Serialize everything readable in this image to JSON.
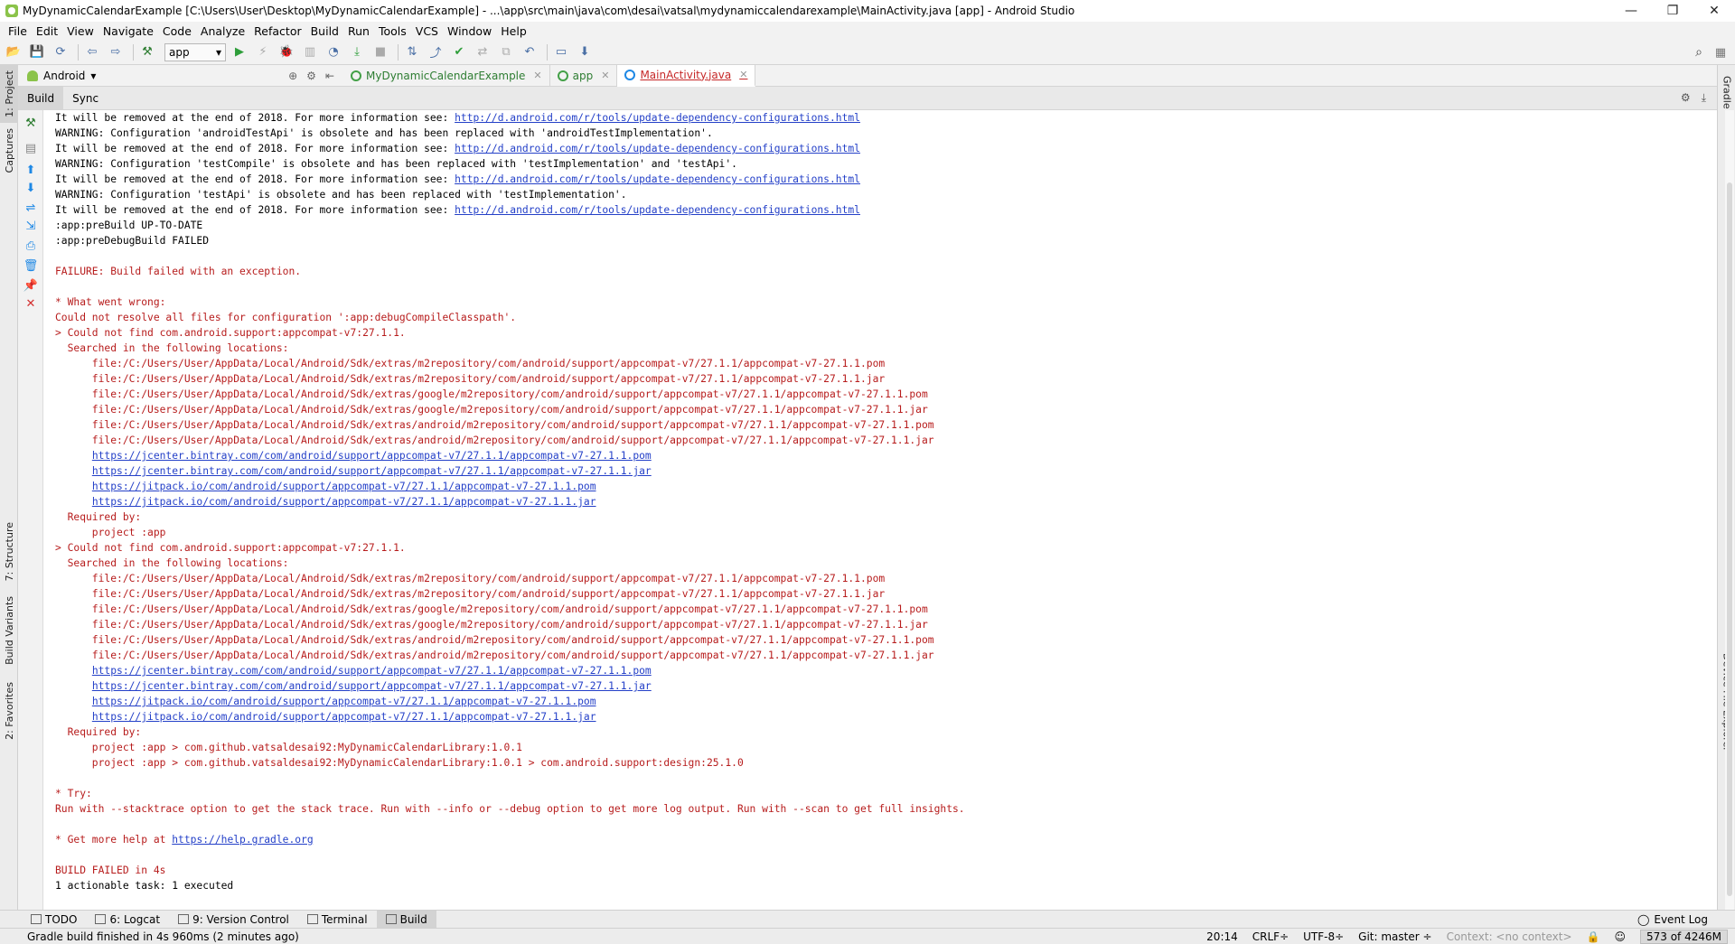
{
  "window": {
    "title": "MyDynamicCalendarExample [C:\\Users\\User\\Desktop\\MyDynamicCalendarExample] - ...\\app\\src\\main\\java\\com\\desai\\vatsal\\mydynamiccalendarexample\\MainActivity.java [app] - Android Studio",
    "minimize": "—",
    "maximize": "❐",
    "close": "✕"
  },
  "menu": [
    "File",
    "Edit",
    "View",
    "Navigate",
    "Code",
    "Analyze",
    "Refactor",
    "Build",
    "Run",
    "Tools",
    "VCS",
    "Window",
    "Help"
  ],
  "toolbar": {
    "run_config": "app"
  },
  "left_tabs": {
    "project": "1: Project",
    "captures": "Captures",
    "structure": "7: Structure",
    "build_variants": "Build Variants",
    "favorites": "2: Favorites"
  },
  "right_tabs": {
    "gradle": "Gradle",
    "device_explorer": "Device File Explorer"
  },
  "project_view": {
    "selector": "Android"
  },
  "editor_tabs": [
    {
      "label": "MyDynamicCalendarExample",
      "icon": "gradle-icon"
    },
    {
      "label": "app",
      "icon": "gradle-icon"
    },
    {
      "label": "MainActivity.java",
      "icon": "class-icon",
      "active": true
    }
  ],
  "build_panel": {
    "tabs": [
      "Build",
      "Sync"
    ]
  },
  "console_lines": [
    {
      "text": "It will be removed at the end of 2018. For more information see: ",
      "link": "http://d.android.com/r/tools/update-dependency-configurations.html",
      "color": "black"
    },
    {
      "text": "WARNING: Configuration 'androidTestApi' is obsolete and has been replaced with 'androidTestImplementation'.",
      "color": "black"
    },
    {
      "text": "It will be removed at the end of 2018. For more information see: ",
      "link": "http://d.android.com/r/tools/update-dependency-configurations.html",
      "color": "black"
    },
    {
      "text": "WARNING: Configuration 'testCompile' is obsolete and has been replaced with 'testImplementation' and 'testApi'.",
      "color": "black"
    },
    {
      "text": "It will be removed at the end of 2018. For more information see: ",
      "link": "http://d.android.com/r/tools/update-dependency-configurations.html",
      "color": "black"
    },
    {
      "text": "WARNING: Configuration 'testApi' is obsolete and has been replaced with 'testImplementation'.",
      "color": "black"
    },
    {
      "text": "It will be removed at the end of 2018. For more information see: ",
      "link": "http://d.android.com/r/tools/update-dependency-configurations.html",
      "color": "black"
    },
    {
      "text": ":app:preBuild UP-TO-DATE",
      "color": "black"
    },
    {
      "text": ":app:preDebugBuild FAILED",
      "color": "black"
    },
    {
      "text": "",
      "color": "black"
    },
    {
      "text": "FAILURE: Build failed with an exception.",
      "color": "red"
    },
    {
      "text": "",
      "color": "red"
    },
    {
      "text": "* What went wrong:",
      "color": "red"
    },
    {
      "text": "Could not resolve all files for configuration ':app:debugCompileClasspath'.",
      "color": "red"
    },
    {
      "text": "> Could not find com.android.support:appcompat-v7:27.1.1.",
      "color": "red"
    },
    {
      "text": "  Searched in the following locations:",
      "color": "red"
    },
    {
      "text": "      file:/C:/Users/User/AppData/Local/Android/Sdk/extras/m2repository/com/android/support/appcompat-v7/27.1.1/appcompat-v7-27.1.1.pom",
      "color": "red"
    },
    {
      "text": "      file:/C:/Users/User/AppData/Local/Android/Sdk/extras/m2repository/com/android/support/appcompat-v7/27.1.1/appcompat-v7-27.1.1.jar",
      "color": "red"
    },
    {
      "text": "      file:/C:/Users/User/AppData/Local/Android/Sdk/extras/google/m2repository/com/android/support/appcompat-v7/27.1.1/appcompat-v7-27.1.1.pom",
      "color": "red"
    },
    {
      "text": "      file:/C:/Users/User/AppData/Local/Android/Sdk/extras/google/m2repository/com/android/support/appcompat-v7/27.1.1/appcompat-v7-27.1.1.jar",
      "color": "red"
    },
    {
      "text": "      file:/C:/Users/User/AppData/Local/Android/Sdk/extras/android/m2repository/com/android/support/appcompat-v7/27.1.1/appcompat-v7-27.1.1.pom",
      "color": "red"
    },
    {
      "text": "      file:/C:/Users/User/AppData/Local/Android/Sdk/extras/android/m2repository/com/android/support/appcompat-v7/27.1.1/appcompat-v7-27.1.1.jar",
      "color": "red"
    },
    {
      "text": "      ",
      "link": "https://jcenter.bintray.com/com/android/support/appcompat-v7/27.1.1/appcompat-v7-27.1.1.pom",
      "color": "red"
    },
    {
      "text": "      ",
      "link": "https://jcenter.bintray.com/com/android/support/appcompat-v7/27.1.1/appcompat-v7-27.1.1.jar",
      "color": "red"
    },
    {
      "text": "      ",
      "link": "https://jitpack.io/com/android/support/appcompat-v7/27.1.1/appcompat-v7-27.1.1.pom",
      "color": "red"
    },
    {
      "text": "      ",
      "link": "https://jitpack.io/com/android/support/appcompat-v7/27.1.1/appcompat-v7-27.1.1.jar",
      "color": "red"
    },
    {
      "text": "  Required by:",
      "color": "red"
    },
    {
      "text": "      project :app",
      "color": "red"
    },
    {
      "text": "> Could not find com.android.support:appcompat-v7:27.1.1.",
      "color": "red"
    },
    {
      "text": "  Searched in the following locations:",
      "color": "red"
    },
    {
      "text": "      file:/C:/Users/User/AppData/Local/Android/Sdk/extras/m2repository/com/android/support/appcompat-v7/27.1.1/appcompat-v7-27.1.1.pom",
      "color": "red"
    },
    {
      "text": "      file:/C:/Users/User/AppData/Local/Android/Sdk/extras/m2repository/com/android/support/appcompat-v7/27.1.1/appcompat-v7-27.1.1.jar",
      "color": "red"
    },
    {
      "text": "      file:/C:/Users/User/AppData/Local/Android/Sdk/extras/google/m2repository/com/android/support/appcompat-v7/27.1.1/appcompat-v7-27.1.1.pom",
      "color": "red"
    },
    {
      "text": "      file:/C:/Users/User/AppData/Local/Android/Sdk/extras/google/m2repository/com/android/support/appcompat-v7/27.1.1/appcompat-v7-27.1.1.jar",
      "color": "red"
    },
    {
      "text": "      file:/C:/Users/User/AppData/Local/Android/Sdk/extras/android/m2repository/com/android/support/appcompat-v7/27.1.1/appcompat-v7-27.1.1.pom",
      "color": "red"
    },
    {
      "text": "      file:/C:/Users/User/AppData/Local/Android/Sdk/extras/android/m2repository/com/android/support/appcompat-v7/27.1.1/appcompat-v7-27.1.1.jar",
      "color": "red"
    },
    {
      "text": "      ",
      "link": "https://jcenter.bintray.com/com/android/support/appcompat-v7/27.1.1/appcompat-v7-27.1.1.pom",
      "color": "red"
    },
    {
      "text": "      ",
      "link": "https://jcenter.bintray.com/com/android/support/appcompat-v7/27.1.1/appcompat-v7-27.1.1.jar",
      "color": "red"
    },
    {
      "text": "      ",
      "link": "https://jitpack.io/com/android/support/appcompat-v7/27.1.1/appcompat-v7-27.1.1.pom",
      "color": "red"
    },
    {
      "text": "      ",
      "link": "https://jitpack.io/com/android/support/appcompat-v7/27.1.1/appcompat-v7-27.1.1.jar",
      "color": "red"
    },
    {
      "text": "  Required by:",
      "color": "red"
    },
    {
      "text": "      project :app > com.github.vatsaldesai92:MyDynamicCalendarLibrary:1.0.1",
      "color": "red"
    },
    {
      "text": "      project :app > com.github.vatsaldesai92:MyDynamicCalendarLibrary:1.0.1 > com.android.support:design:25.1.0",
      "color": "red"
    },
    {
      "text": "",
      "color": "red"
    },
    {
      "text": "* Try:",
      "color": "red"
    },
    {
      "text": "Run with --stacktrace option to get the stack trace. Run with --info or --debug option to get more log output. Run with --scan to get full insights.",
      "color": "red"
    },
    {
      "text": "",
      "color": "red"
    },
    {
      "text": "* Get more help at ",
      "link": "https://help.gradle.org",
      "color": "red"
    },
    {
      "text": "",
      "color": "red"
    },
    {
      "text": "BUILD FAILED in 4s",
      "color": "red"
    },
    {
      "text": "1 actionable task: 1 executed",
      "color": "black"
    }
  ],
  "bottom_tabs": [
    {
      "label": "TODO",
      "icon": "todo-icon"
    },
    {
      "label": "6: Logcat",
      "icon": "logcat-icon"
    },
    {
      "label": "9: Version Control",
      "icon": "vcs-icon"
    },
    {
      "label": "Terminal",
      "icon": "terminal-icon"
    },
    {
      "label": "Build",
      "icon": "build-icon",
      "active": true
    }
  ],
  "event_log": "Event Log",
  "status": {
    "message": "Gradle build finished in 4s 960ms (2 minutes ago)",
    "position": "20:14",
    "line_sep": "CRLF÷",
    "encoding": "UTF-8÷",
    "git": "Git: master ÷",
    "context": "Context: <no context>",
    "memory": "573 of 4246M"
  }
}
